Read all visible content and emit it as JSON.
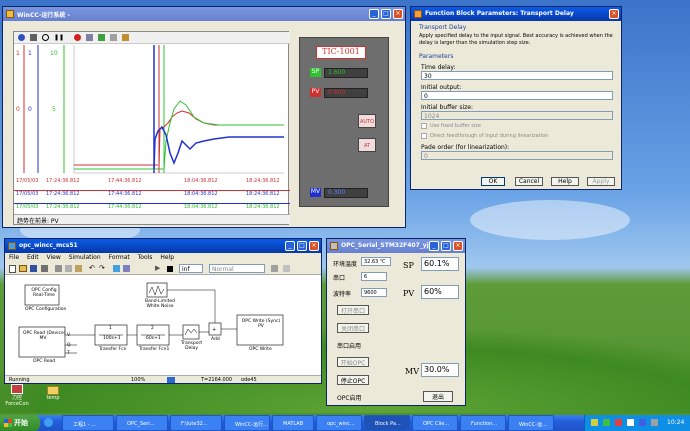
{
  "wincc": {
    "title": "WinCC-运行系统 -",
    "tag": "TIC-1001",
    "sp_label": "SP",
    "sp_value": "1.600",
    "pv_label": "PV",
    "pv_value": "0.600",
    "mv_label": "MV",
    "mv_value": "0.300",
    "auto_button": "AUTO",
    "at_button": "AT",
    "trend_dates": [
      "17/05/03",
      "17/05/03",
      "17/05/03"
    ],
    "trend_times_a": [
      "17:24:36.812",
      "17:24:36.812",
      "17:24:36.812"
    ],
    "trend_times_b": [
      "17:44:36.812",
      "17:44:36.812",
      "17:44:36.812"
    ],
    "trend_times_c": [
      "18:04:36.812",
      "18:04:36.812",
      "18:04:36.812"
    ],
    "trend_times_d": [
      "18:24:36.812",
      "18:24:36.812",
      "18:24:36.812"
    ],
    "y_top": "1",
    "y_mid": "0",
    "y_green_top": "10",
    "y_green_mid": "5",
    "status": "趋势在前景: PV",
    "colors": {
      "sp": "#d03030",
      "pv": "#30c030",
      "mv": "#2030d0"
    }
  },
  "fbp": {
    "title": "Function Block Parameters: Transport Delay",
    "section": "Transport Delay",
    "description": "Apply specified delay to the input signal.  Best accuracy is achieved when the delay is larger than the simulation step size.",
    "params_header": "Parameters",
    "time_delay_label": "Time delay:",
    "time_delay_value": "30",
    "initial_output_label": "Initial output:",
    "initial_output_value": "0",
    "initial_buffer_label": "Initial buffer size:",
    "initial_buffer_value": "1024",
    "check1": "Use fixed buffer size",
    "check2": "Direct feedthrough of input during linearization",
    "pade_label": "Pade order (for linearization):",
    "pade_value": "0",
    "ok": "OK",
    "cancel": "Cancel",
    "help": "Help",
    "apply": "Apply"
  },
  "sim": {
    "title": "opc_wincc_mcs51",
    "menu": [
      "File",
      "Edit",
      "View",
      "Simulation",
      "Format",
      "Tools",
      "Help"
    ],
    "stop_time": "inf",
    "mode": "Normal",
    "blocks": {
      "opc_config": "OPC Config\nReal-Time",
      "opc_config_label": "OPC Configuration",
      "noise_label": "Band-Limited\nWhite Noise",
      "opc_read": "OPC Read (Device)\nMV",
      "opc_read_label": "OPC Read",
      "tf1_num": "1",
      "tf1_den": "100s+1",
      "tf1_label": "Transfer Fcn",
      "tf2_num": "2",
      "tf2_den": "60s+1",
      "tf2_label": "Transfer Fcn1",
      "delay_label": "Transport\nDelay",
      "add_label": "Add",
      "opc_write": "OPC Write (Sync)\nPV",
      "opc_write_label": "OPC Write",
      "ports": [
        "V",
        "Q",
        "T"
      ]
    },
    "status_left": "Running",
    "status_zoom": "100%",
    "status_time": "T=2164.000",
    "status_solver": "ode45"
  },
  "serial": {
    "title": "OPC_Serial_STM32F407_yjj",
    "temp_label": "环境温度",
    "temp_value": "32.63 ℃",
    "port_label": "串口",
    "port_value": "6",
    "baud_label": "波特率",
    "baud_value": "9600",
    "open_port": "打开串口",
    "close_port": "关闭串口",
    "port_enabled": "串口启用",
    "start_opc": "开始OPC",
    "stop_opc": "停止OPC",
    "opc_enabled": "OPC启用",
    "sp_label": "SP",
    "sp_value": "60.1%",
    "pv_label": "PV",
    "pv_value": "60%",
    "mv_label": "MV",
    "mv_value": "30.0%",
    "exit": "退出"
  },
  "desktop": {
    "icon1": "力控\nForceCon",
    "icon2": "temp"
  },
  "taskbar": {
    "start": "开始",
    "items": [
      "工程1 - ...",
      "OPC_Seri...",
      "F:\\lute32...",
      "WinCC-运行...",
      "MATLAB",
      "opc_winc...",
      "Block Pa...",
      "OPC Clie...",
      "Function...",
      "WinCC-运..."
    ],
    "clock": "10:24"
  }
}
